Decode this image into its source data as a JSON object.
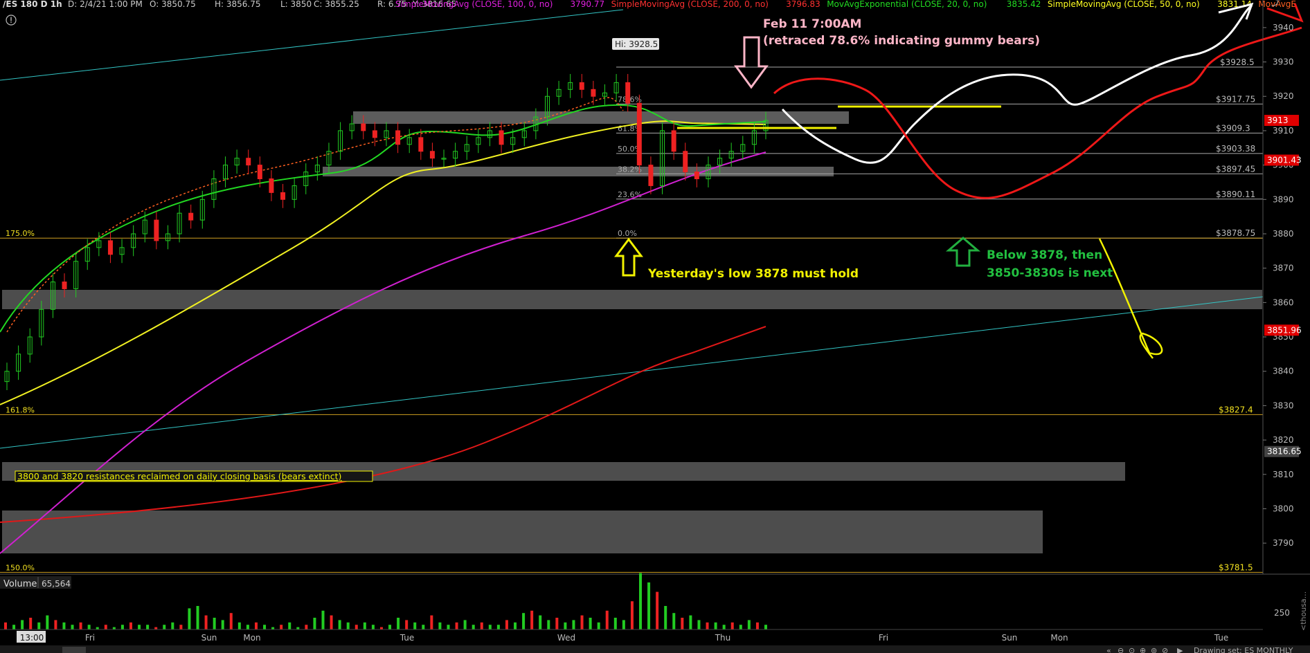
{
  "header": {
    "symbol": "/ES 180 D 1h",
    "date": "D: 2/4/21 1:00 PM",
    "open": "O: 3850.75",
    "high": "H: 3856.75",
    "low": "L: 3850",
    "close": "C: 3855.25",
    "range": "R: 6.75",
    "y": "Y: 3816.65",
    "studies": [
      {
        "label": "SimpleMovingAvg (CLOSE, 100, 0, no)",
        "value": "3790.77",
        "color": "#e020e0"
      },
      {
        "label": "SimpleMovingAvg (CLOSE, 200, 0, no)",
        "value": "3796.83",
        "color": "#ff3030"
      },
      {
        "label": "MovAvgExponential (CLOSE, 20, 0, no)",
        "value": "3835.42",
        "color": "#22dd22"
      },
      {
        "label": "SimpleMovingAvg (CLOSE, 50, 0, no)",
        "value": "3831.14",
        "color": "#ffff22"
      },
      {
        "label": "MovAvgE",
        "value": "",
        "color": "#ff6020"
      }
    ]
  },
  "chart_data": {
    "type": "candlestick",
    "y_range": [
      3785,
      3944
    ],
    "y_ticks": [
      3790,
      3800,
      3810,
      3820,
      3830,
      3840,
      3850,
      3860,
      3870,
      3880,
      3890,
      3900,
      3910,
      3920,
      3930,
      3940
    ],
    "x_labels": [
      "13:00",
      "Fri",
      "Sun",
      "Mon",
      "Tue",
      "Wed",
      "Thu",
      "Fri",
      "Sun",
      "Mon",
      "Tue"
    ],
    "price_tags": [
      {
        "value": "3913",
        "color": "#e00000"
      },
      {
        "value": "3901.43",
        "color": "#e00000"
      },
      {
        "value": "3851.96",
        "color": "#e00000"
      },
      {
        "value": "3816.65",
        "color": "#444444"
      }
    ],
    "fib_levels": [
      {
        "pct": "78.6%",
        "price": "3917.75"
      },
      {
        "pct": "61.8%",
        "price": "3909.3"
      },
      {
        "pct": "50.0%",
        "price": "3903.38"
      },
      {
        "pct": "38.2%",
        "price": "3897.45"
      },
      {
        "pct": "23.6%",
        "price": "3890.11"
      },
      {
        "pct": "0.0%",
        "price": "3878.75"
      }
    ],
    "extensions": [
      {
        "pct": "175.0%",
        "price": "3878.75"
      },
      {
        "pct": "161.8%",
        "price": "3827.4"
      },
      {
        "pct": "150.0%",
        "price": "3781.5"
      }
    ],
    "hi_label": "Hi: 3928.5",
    "hi_price": "$3928.5",
    "closes": [
      3840,
      3845,
      3850,
      3858,
      3866,
      3864,
      3872,
      3876,
      3878,
      3874,
      3876,
      3880,
      3884,
      3878,
      3880,
      3886,
      3884,
      3890,
      3896,
      3900,
      3902,
      3900,
      3896,
      3892,
      3890,
      3894,
      3898,
      3900,
      3904,
      3910,
      3912,
      3910,
      3908,
      3910,
      3906,
      3908,
      3904,
      3902,
      3902,
      3904,
      3906,
      3908,
      3910,
      3906,
      3908,
      3910,
      3914,
      3920,
      3922,
      3924,
      3922,
      3920,
      3921,
      3924,
      3918,
      3900,
      3894,
      3910,
      3904,
      3898,
      3896,
      3900,
      3902,
      3904,
      3906,
      3910,
      3913
    ]
  },
  "annotations": {
    "feb11_title": "Feb 11 7:00AM",
    "feb11_sub": "(retraced 78.6% indicating gummy bears)",
    "yesterday_low": "Yesterday's low 3878 must hold",
    "below_line1": "Below 3878, then",
    "below_line2": "3850-3830s is next",
    "resistance_note": "3800 and 3820 resistances reclaimed on daily closing basis (bears extinct)"
  },
  "volume": {
    "label": "Volume",
    "value": "65,564",
    "scale": "250",
    "axis_label": "<thousa...",
    "bars": [
      3,
      2,
      4,
      5,
      3,
      6,
      4,
      3,
      2,
      3,
      2,
      1,
      2,
      1,
      2,
      3,
      2,
      2,
      1,
      2,
      3,
      2,
      9,
      10,
      6,
      5,
      4,
      7,
      3,
      2,
      3,
      2,
      1,
      2,
      3,
      1,
      2,
      5,
      8,
      6,
      4,
      3,
      2,
      3,
      2,
      1,
      2,
      5,
      4,
      3,
      2,
      6,
      3,
      2,
      3,
      4,
      2,
      3,
      2,
      2,
      4,
      3,
      7,
      8,
      6,
      4,
      5,
      3,
      4,
      6,
      5,
      3,
      8,
      5,
      4,
      12,
      24,
      20,
      16,
      10,
      7,
      5,
      6,
      4,
      3,
      3,
      2,
      3,
      2,
      4,
      3,
      2
    ]
  },
  "footer": {
    "drawing": "Drawing set: ES MONTHLY"
  }
}
